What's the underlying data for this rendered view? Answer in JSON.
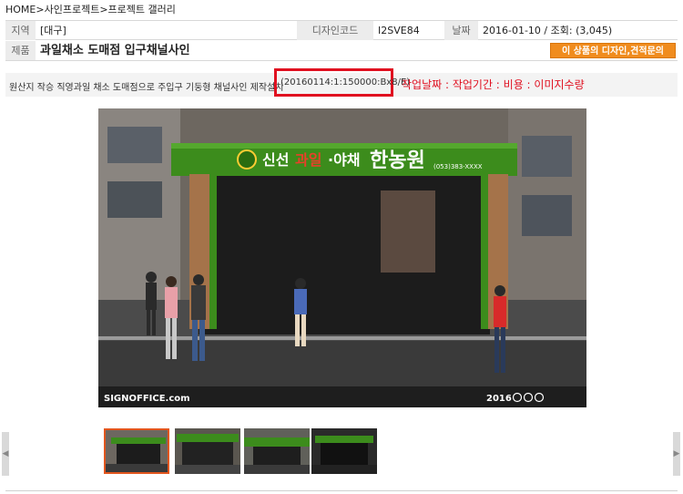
{
  "breadcrumb": [
    "HOME",
    ">사인프로젝트",
    ">프로젝트 갤러리"
  ],
  "info": {
    "region_label": "지역",
    "region_value": "[대구]",
    "design_code_label": "디자인코드",
    "design_code_value": "I2SVE84",
    "date_label": "날짜",
    "date_value": "2016-01-10 / 조회: (3,045)",
    "product_label": "제품",
    "product_value": "과일채소 도매점 입구채널사인",
    "inquiry_button": "이 상품의 디자인,견적문의"
  },
  "description": {
    "text": "원산지 작승 직영과일 채소 도매점으로 주입구 기둥형 채널사인 제작설치",
    "code": "(20160114:1:150000:Bx8/E)",
    "annotation": "작업날짜 : 작업기간 : 비용 : 이미지수량"
  },
  "image": {
    "sign_text_main_a": "신선",
    "sign_text_main_b": "과일",
    "sign_text_main_c": "·야채",
    "sign_text_brand": "한농원",
    "sign_phone": "(053)383-XXXX",
    "watermark": "SIGNOFFICE.com",
    "year_badge": "2016"
  },
  "thumbnails": [
    "thumb-1",
    "thumb-2",
    "thumb-3",
    "thumb-4"
  ],
  "nav": {
    "prev": "◀",
    "next": "▶"
  },
  "colors": {
    "accent_orange": "#f08c1e",
    "sign_green": "#3c8c1c",
    "annotation_red": "#e01020",
    "title_blue": "#1a3d8c"
  }
}
